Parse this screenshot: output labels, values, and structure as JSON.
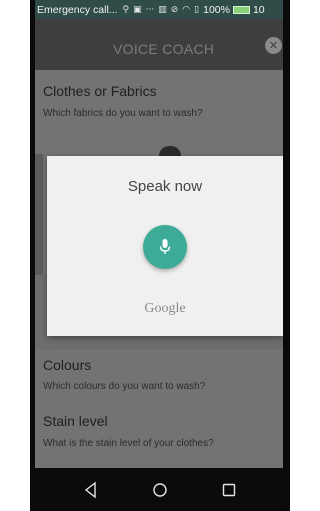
{
  "status_bar": {
    "carrier_text": "Emergency call...",
    "icons": [
      "usb-icon",
      "image-icon",
      "more-dots-icon",
      "sim-icon",
      "no-vibrate-icon",
      "wifi-icon",
      "vibrate-icon"
    ],
    "battery_text": "100%",
    "time_text": "10",
    "battery_color": "#8bd17a"
  },
  "app_bar": {
    "title": "VOICE COACH",
    "close_icon": "close-icon"
  },
  "questions": [
    {
      "title": "Clothes or Fabrics",
      "subtitle": "Which fabrics do you want to wash?"
    },
    {
      "title": "Colours",
      "subtitle": "Which colours do you want to wash?"
    },
    {
      "title": "Stain level",
      "subtitle": "What is the stain level of your clothes?"
    }
  ],
  "voice_dialog": {
    "prompt": "Speak now",
    "mic_icon": "microphone-icon",
    "mic_color": "#3dab98",
    "brand": "Google"
  },
  "nav_bar": {
    "back_icon": "back-triangle-icon",
    "home_icon": "home-circle-icon",
    "recents_icon": "recents-square-icon"
  }
}
